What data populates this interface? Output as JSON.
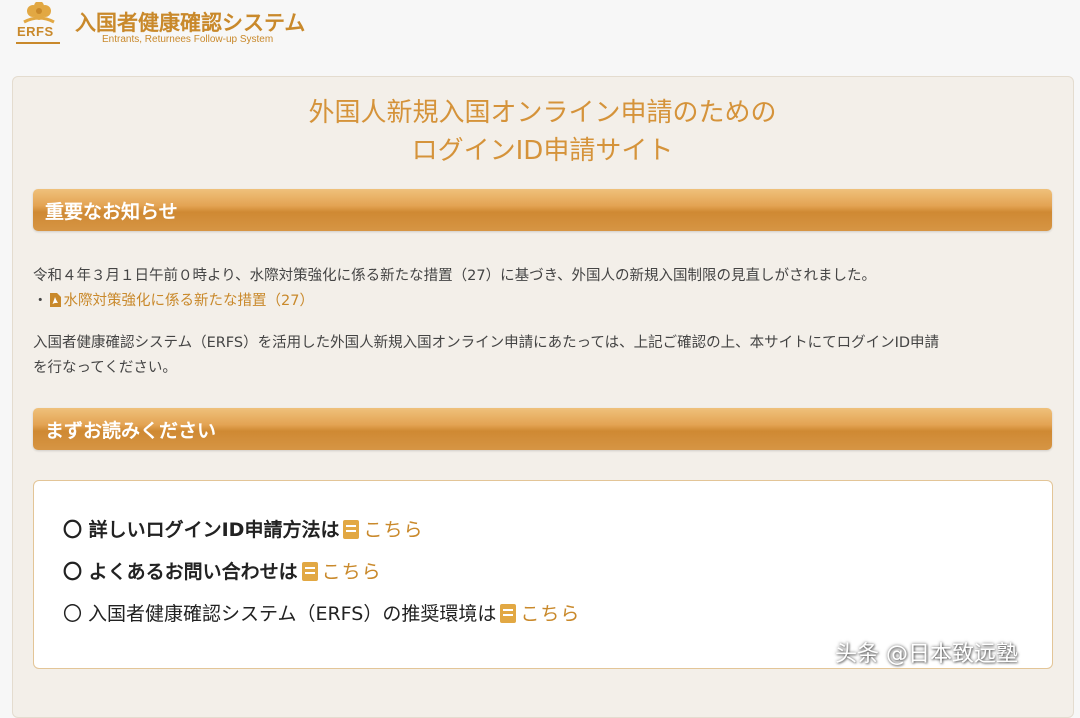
{
  "header": {
    "logo_text": "ERFS",
    "title": "入国者健康確認システム",
    "subtitle": "Entrants, Returnees Follow-up System"
  },
  "page": {
    "title_line1": "外国人新規入国オンライン申請のための",
    "title_line2": "ログインID申請サイト"
  },
  "notice_section": {
    "heading": "重要なお知らせ",
    "line1": "令和４年３月１日午前０時より、水際対策強化に係る新たな措置（27）に基づき、外国人の新規入国制限の見直しがされました。",
    "bullet": "・",
    "link_label": "水際対策強化に係る新たな措置（27）",
    "line2": "入国者健康確認システム（ERFS）を活用した外国人新規入国オンライン申請にあたっては、上記ご確認の上、本サイトにてログインID申請",
    "line3": "を行なってください。"
  },
  "read_section": {
    "heading": "まずお読みください",
    "items": [
      {
        "text": "〇 詳しいログインID申請方法は",
        "link_label": "こちら"
      },
      {
        "text": "〇 よくあるお問い合わせは",
        "link_label": "こちら"
      },
      {
        "text": "〇 入国者健康確認システム（ERFS）の推奨環境は",
        "link_label": "こちら"
      }
    ]
  },
  "watermark": "头条 @日本致远塾",
  "colors": {
    "accent": "#c9892b",
    "title": "#d5933a",
    "card_bg": "#f3efe9",
    "box_border": "#e3c597"
  },
  "icons": [
    "flower-logo-icon",
    "pdf-icon",
    "book-icon"
  ]
}
